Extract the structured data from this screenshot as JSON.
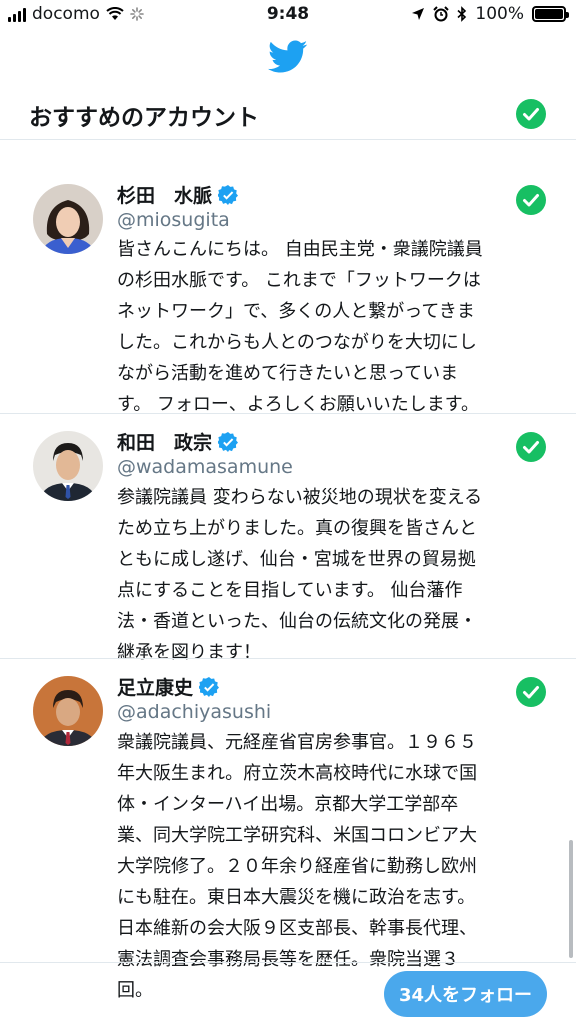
{
  "status_bar": {
    "carrier": "docomo",
    "time": "9:48",
    "battery": "100%",
    "battery_level": 1.0
  },
  "section": {
    "title": "おすすめのアカウント"
  },
  "accounts": [
    {
      "name": "杉田　水脈",
      "handle": "@miosugita",
      "bio": "皆さんこんにちは。 自由民主党・衆議院議員\nの杉田水脈です。 これまで「フットワークは\nネットワーク」で、多くの人と繋がってきま\nした。これからも人とのつながりを大切にし\nながら活動を進めて行きたいと思っていま\nす。 フォロー、よろしくお願いいたします。"
    },
    {
      "name": "和田　政宗",
      "handle": "@wadamasamune",
      "bio": "参議院議員 変わらない被災地の現状を変える\nため立ち上がりました。真の復興を皆さんと\nともに成し遂げ、仙台・宮城を世界の貿易拠\n点にすることを目指しています。 仙台藩作\n法・香道といった、仙台の伝統文化の発展・\n継承を図ります！"
    },
    {
      "name": "足立康史",
      "handle": "@adachiyasushi",
      "bio": "衆議院議員、元経産省官房参事官。１９６５\n年大阪生まれ。府立茨木高校時代に水球で国\n体・インターハイ出場。京都大学工学部卒\n業、同大学院工学研究科、米国コロンビア大\n大学院修了。２０年余り経産省に勤務し欧州\nにも駐在。東日本大震災を機に政治を志す。\n日本維新の会大阪９区支部長、幹事長代理、\n憲法調査会事務局長等を歴任。衆院当選３\n回。"
    }
  ],
  "follow_button": {
    "label": "34人をフォロー"
  },
  "colors": {
    "twitter_blue": "#1da1f2",
    "check_green": "#17bf63",
    "button_blue": "#4aa8ec",
    "handle_gray": "#657786"
  },
  "icons": [
    "cell-signal-icon",
    "wifi-icon",
    "loading-spinner-icon",
    "location-arrow-icon",
    "alarm-icon",
    "bluetooth-icon",
    "battery-icon",
    "twitter-bird-icon",
    "verified-badge-icon",
    "check-circle-icon"
  ]
}
